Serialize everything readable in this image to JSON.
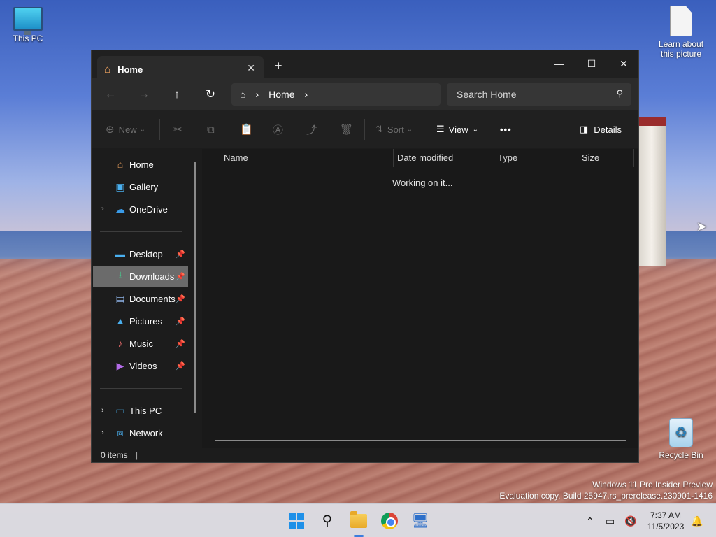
{
  "desktop": {
    "icons": [
      {
        "label": "This PC"
      },
      {
        "label": "Learn about this picture"
      },
      {
        "label": "Recycle Bin"
      }
    ],
    "watermark_line1": "Windows 11 Pro Insider Preview",
    "watermark_line2": "Evaluation copy. Build 25947.rs_prerelease.230901-1416"
  },
  "window": {
    "tab_title": "Home",
    "breadcrumb": [
      "Home"
    ],
    "search_placeholder": "Search Home",
    "toolbar": {
      "new_label": "New",
      "sort_label": "Sort",
      "view_label": "View",
      "more_label": "•••",
      "details_label": "Details"
    },
    "sidebar": {
      "top": [
        {
          "label": "Home",
          "icon": "home-icon"
        },
        {
          "label": "Gallery",
          "icon": "gallery-icon"
        },
        {
          "label": "OneDrive",
          "icon": "cloud-icon"
        }
      ],
      "pinned": [
        {
          "label": "Desktop",
          "icon": "desktop-icon"
        },
        {
          "label": "Downloads",
          "icon": "download-icon",
          "selected": true
        },
        {
          "label": "Documents",
          "icon": "documents-icon"
        },
        {
          "label": "Pictures",
          "icon": "pictures-icon"
        },
        {
          "label": "Music",
          "icon": "music-icon"
        },
        {
          "label": "Videos",
          "icon": "videos-icon"
        }
      ],
      "bottom": [
        {
          "label": "This PC",
          "icon": "computer-icon"
        },
        {
          "label": "Network",
          "icon": "network-icon"
        }
      ]
    },
    "columns": [
      "Name",
      "Date modified",
      "Type",
      "Size"
    ],
    "status_message": "Working on it...",
    "status_bar": "0 items"
  },
  "taskbar": {
    "time": "7:37 AM",
    "date": "11/5/2023",
    "apps": [
      "start",
      "search",
      "file-explorer",
      "chrome",
      "remote-desktop"
    ]
  },
  "colors": {
    "accent": "#1e90e8",
    "window_bg": "#1c1c1c",
    "selected_bg": "#6b6b6b"
  }
}
